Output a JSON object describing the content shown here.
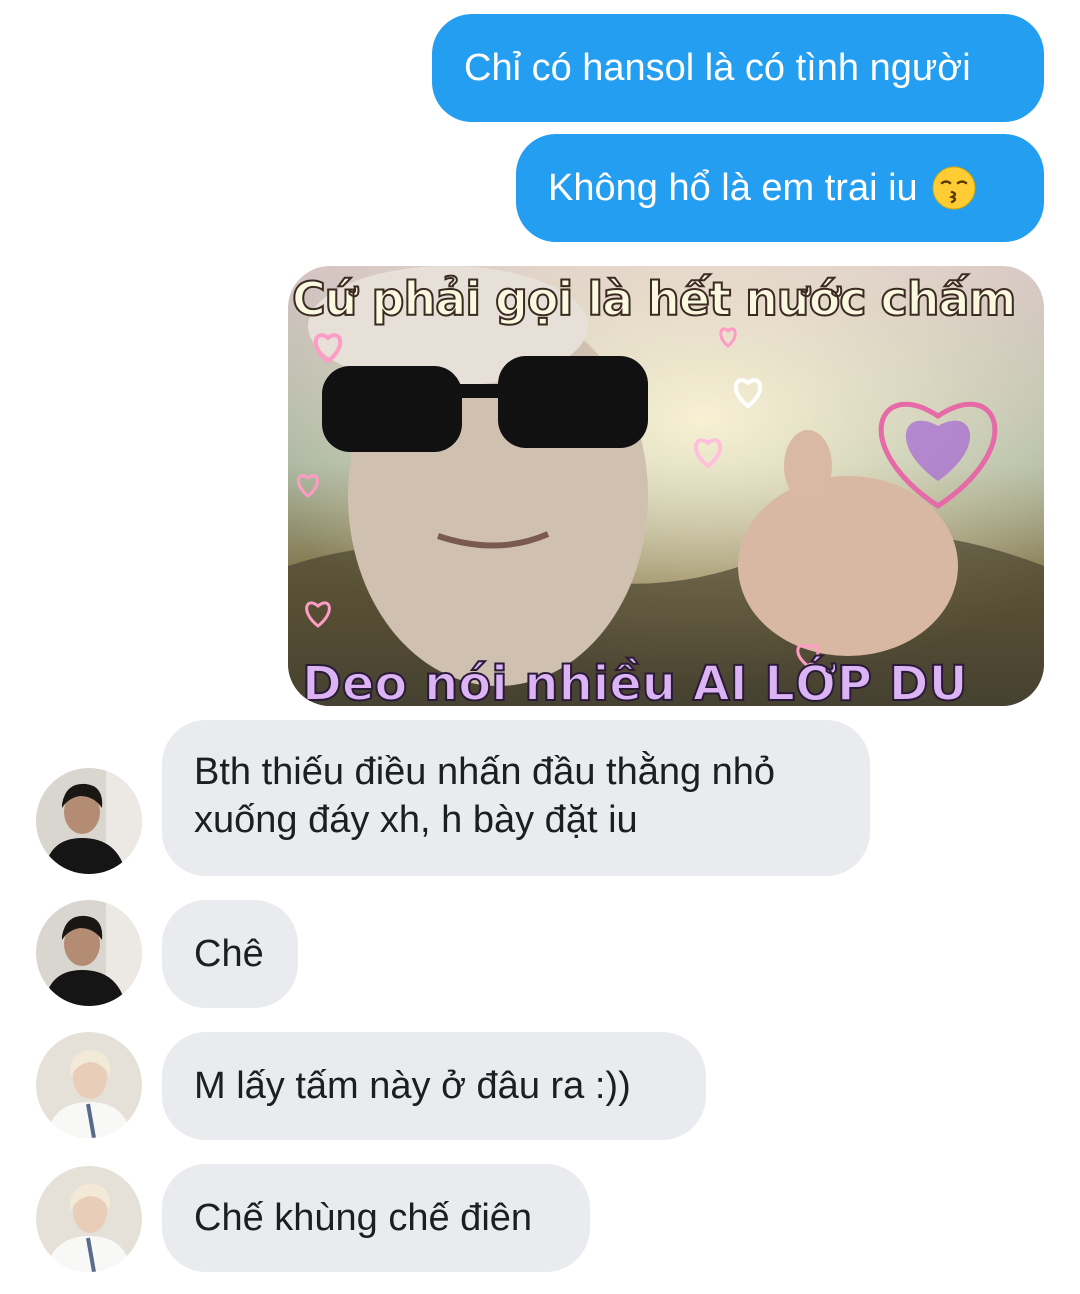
{
  "messages_out": [
    {
      "text": "Chỉ có hansol là có tình người"
    },
    {
      "text": "Không hổ là em trai iu",
      "emoji": "kissing-face-emoji"
    }
  ],
  "sticker": {
    "top_caption": "Cứ phải gọi là hết nước chấm",
    "bottom_caption": "Deo nói nhiều AI LỚP DU"
  },
  "messages_in": [
    {
      "text": "Bth thiếu điều nhấn đầu thằng nhỏ xuống đáy xh, h bày đặt iu",
      "avatar": "dark-hair-avatar"
    },
    {
      "text": "Chê",
      "avatar": "dark-hair-avatar"
    },
    {
      "text": "M lấy tấm này ở đâu ra :))",
      "avatar": "blonde-hair-avatar"
    },
    {
      "text": "Chế khùng chế điên",
      "avatar": "blonde-hair-avatar"
    }
  ],
  "colors": {
    "outgoing_bubble": "#239ef0",
    "incoming_bubble": "#e9ebee"
  }
}
